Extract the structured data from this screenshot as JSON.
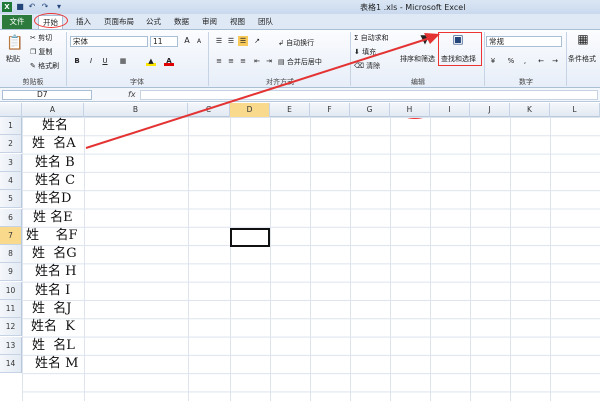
{
  "titlebar": {
    "title": "表格1 .xls - Microsoft Excel"
  },
  "tabs": [
    {
      "label": "文件"
    },
    {
      "label": "开始"
    },
    {
      "label": "插入"
    },
    {
      "label": "页面布局"
    },
    {
      "label": "公式"
    },
    {
      "label": "数据"
    },
    {
      "label": "审阅"
    },
    {
      "label": "视图"
    },
    {
      "label": "团队"
    }
  ],
  "clipboard": {
    "paste": "粘贴",
    "cut": "剪切",
    "copy": "复制",
    "format_painter": "格式刷",
    "label": "剪贴板"
  },
  "font": {
    "name": "宋体",
    "size": "11",
    "bold": "B",
    "italic": "I",
    "underline": "U",
    "label": "字体",
    "grow": "A",
    "shrink": "A",
    "font_color_glyph": "A",
    "font_color": "#e00000",
    "fill_color": "#ffe600"
  },
  "alignment": {
    "wrap": "自动换行",
    "merge": "合并后居中",
    "label": "对齐方式"
  },
  "number": {
    "format": "常规",
    "percent": "%",
    "comma": ",",
    "label": "数字"
  },
  "editing": {
    "autosum": "自动求和",
    "fill": "填充",
    "clear": "清除",
    "sort_filter": "排序和筛选",
    "find_select": "查找和选择",
    "label": "编辑"
  },
  "styles": {
    "conditional": "条件格式"
  },
  "formula_bar": {
    "cell_ref": "D7",
    "fx": "fx",
    "value": ""
  },
  "columns": [
    "A",
    "B",
    "C",
    "D",
    "E",
    "F",
    "G",
    "H",
    "I",
    "J",
    "K",
    "L"
  ],
  "rows": [
    "1",
    "2",
    "3",
    "4",
    "5",
    "6",
    "7",
    "8",
    "9",
    "10",
    "11",
    "12",
    "13",
    "14"
  ],
  "cells_a": [
    "姓名",
    "姓  名A",
    "姓名 B",
    "姓名 C",
    "姓名D",
    "姓 名E",
    "姓    名F",
    "姓  名G",
    "姓名 H",
    "姓名 I",
    "姓  名J",
    "姓名  K",
    "姓  名L",
    "姓名 M"
  ],
  "selected_cell": "D7",
  "annotation_color": "#e33333"
}
